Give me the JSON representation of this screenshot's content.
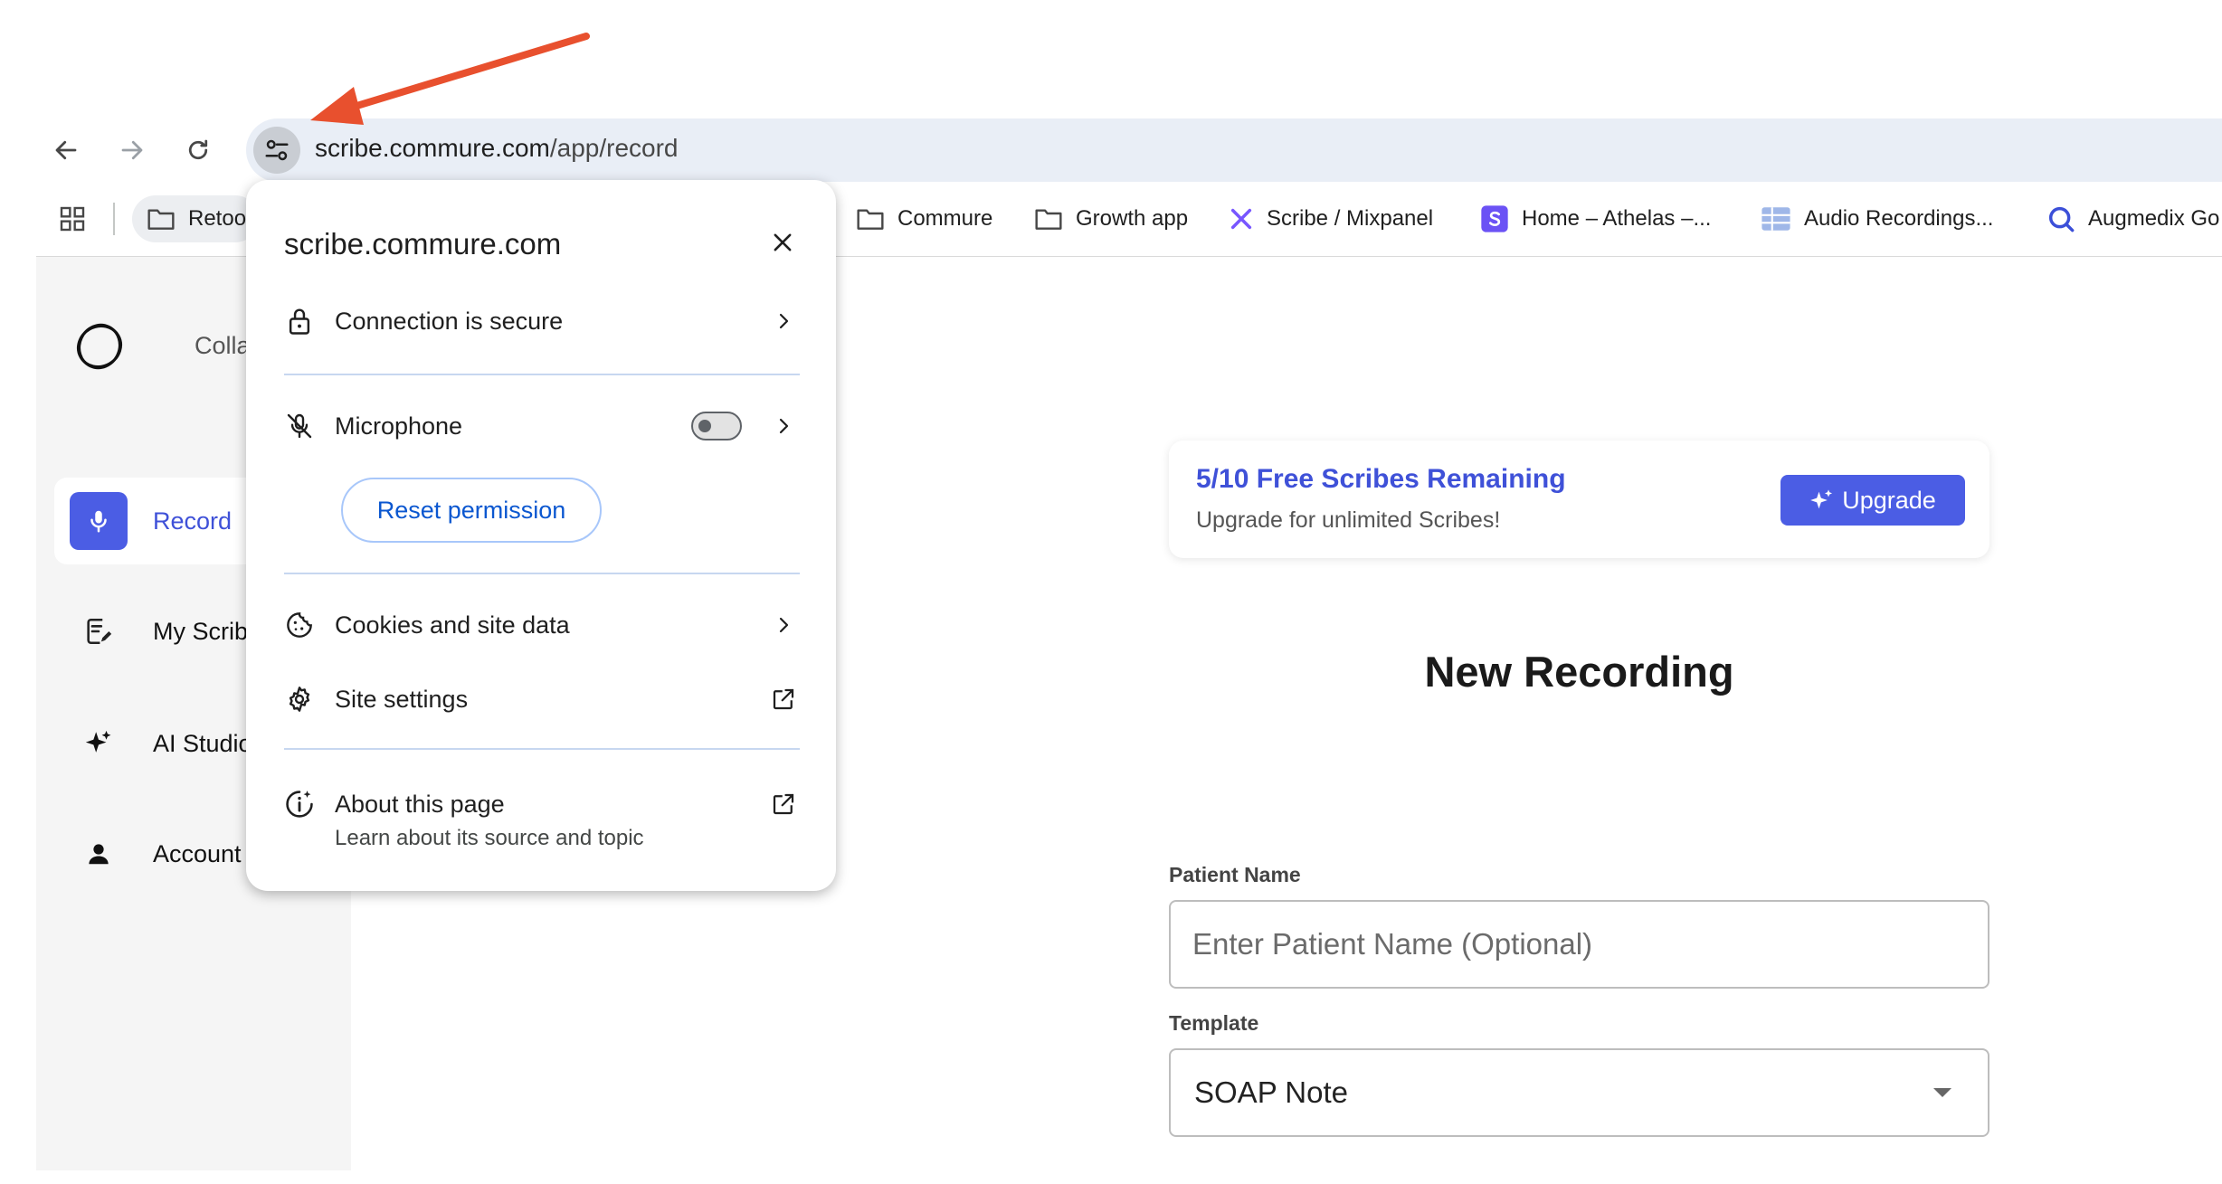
{
  "browser": {
    "url_host": "scribe.commure.com",
    "url_path": "/app/record",
    "bookmarks": [
      {
        "label": "Retool"
      },
      {
        "label": "Commure"
      },
      {
        "label": "Growth app"
      },
      {
        "label": "Scribe / Mixpanel"
      },
      {
        "label": "Home – Athelas –..."
      },
      {
        "label": "Audio Recordings..."
      },
      {
        "label": "Augmedix Go"
      }
    ]
  },
  "sidebar": {
    "collapse_label": "Collapse",
    "items": [
      {
        "label": "Record"
      },
      {
        "label": "My Scribes"
      },
      {
        "label": "AI Studio"
      },
      {
        "label": "Account"
      }
    ]
  },
  "main": {
    "banner_title": "5/10 Free Scribes Remaining",
    "banner_subtitle": "Upgrade for unlimited Scribes!",
    "upgrade_label": "Upgrade",
    "page_title": "New Recording",
    "patient_label": "Patient Name",
    "patient_placeholder": "Enter Patient Name (Optional)",
    "template_label": "Template",
    "template_value": "SOAP Note"
  },
  "popover": {
    "host": "scribe.commure.com",
    "connection": "Connection is secure",
    "microphone": "Microphone",
    "reset_permission": "Reset permission",
    "cookies": "Cookies and site data",
    "site_settings": "Site settings",
    "about": "About this page",
    "about_sub": "Learn about its source and topic"
  },
  "colors": {
    "accent": "#4b5de4",
    "annotation_arrow": "#e8502e"
  }
}
